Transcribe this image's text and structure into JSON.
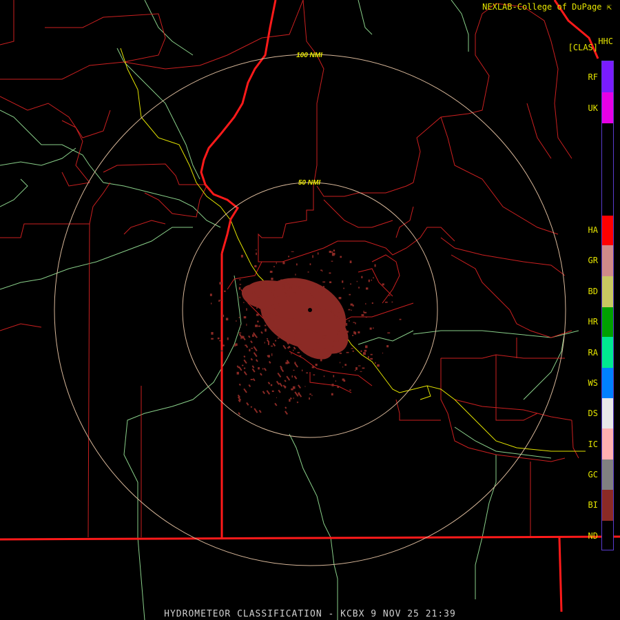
{
  "header": {
    "credit": "NEXLAB-College of DuPage",
    "product_code": "HHC",
    "product_class": "[CLAS]"
  },
  "footer": {
    "title": "HYDROMETEOR CLASSIFICATION - KCBX 9 NOV 25 21:39"
  },
  "range_rings": [
    {
      "label": "50 NMI"
    },
    {
      "label": "100 NMI"
    }
  ],
  "colors": {
    "ring": "#d9b89a",
    "state_border": "#ff1a1a",
    "county_border": "#cc2020",
    "highway_green": "#8ad08a",
    "highway_yellow": "#e5e500",
    "echo": "#8b2a25"
  },
  "legend": [
    {
      "code": "RF",
      "color": "#7a1cff"
    },
    {
      "code": "UK",
      "color": "#e600e6"
    },
    {
      "code": "HA",
      "color": "#ff0000"
    },
    {
      "code": "GR",
      "color": "#d08a88"
    },
    {
      "code": "BD",
      "color": "#c8c860"
    },
    {
      "code": "HR",
      "color": "#00a000"
    },
    {
      "code": "RA",
      "color": "#00e890"
    },
    {
      "code": "WS",
      "color": "#0080ff"
    },
    {
      "code": "DS",
      "color": "#e8e8e8"
    },
    {
      "code": "IC",
      "color": "#ffb0b0"
    },
    {
      "code": "GC",
      "color": "#808080"
    },
    {
      "code": "BI",
      "color": "#8b2a25"
    },
    {
      "code": "ND",
      "color": "#000000"
    }
  ]
}
